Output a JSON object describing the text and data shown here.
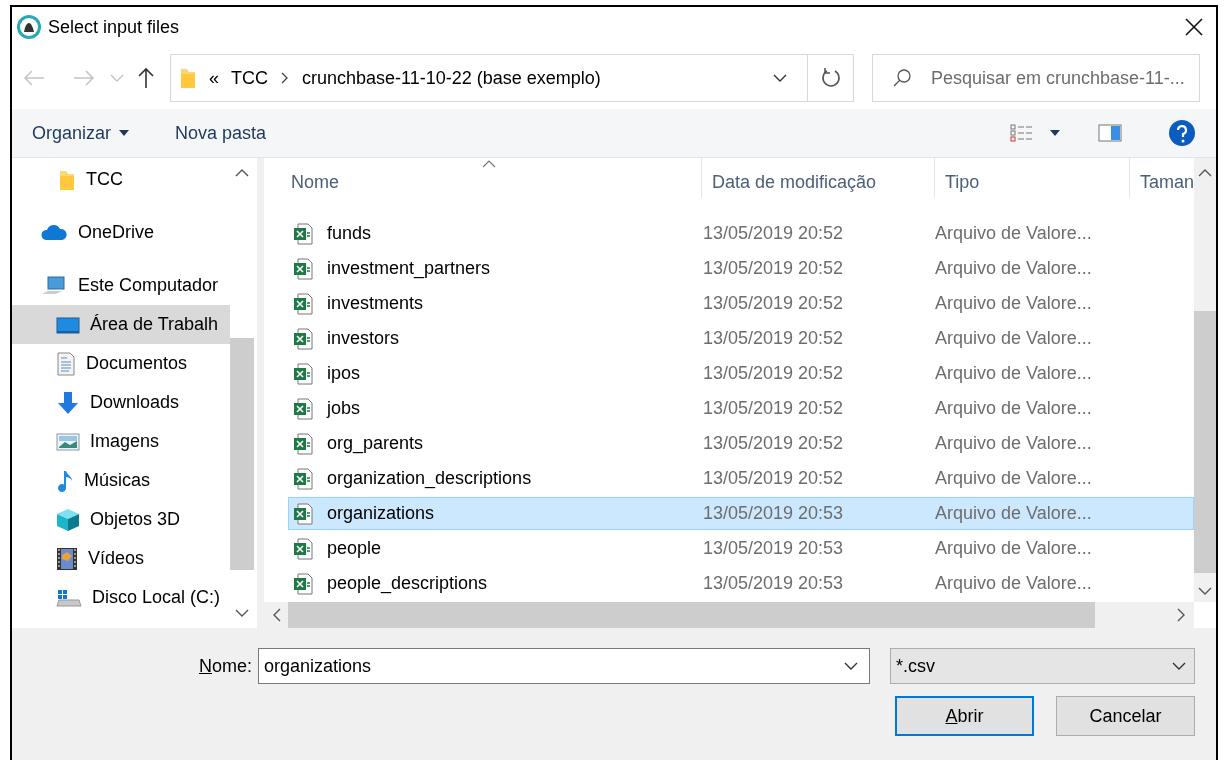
{
  "window": {
    "title": "Select input files"
  },
  "address": {
    "overflow": "«",
    "segments": [
      "TCC",
      "crunchbase-11-10-22 (base exemplo)"
    ]
  },
  "search": {
    "placeholder": "Pesquisar em crunchbase-11-..."
  },
  "toolbar": {
    "organize": "Organizar",
    "new_folder": "Nova pasta"
  },
  "nav_pane": {
    "items": [
      {
        "label": "TCC",
        "kind": "folder",
        "selected": false
      },
      {
        "label": "OneDrive",
        "kind": "cloud",
        "selected": false
      },
      {
        "label": "Este Computador",
        "kind": "computer",
        "selected": false,
        "children": [
          {
            "label": "Área de Trabalh",
            "kind": "desktop",
            "selected": true
          },
          {
            "label": "Documentos",
            "kind": "documents",
            "selected": false
          },
          {
            "label": "Downloads",
            "kind": "downloads",
            "selected": false
          },
          {
            "label": "Imagens",
            "kind": "pictures",
            "selected": false
          },
          {
            "label": "Músicas",
            "kind": "music",
            "selected": false
          },
          {
            "label": "Objetos 3D",
            "kind": "objects3d",
            "selected": false
          },
          {
            "label": "Vídeos",
            "kind": "videos",
            "selected": false
          },
          {
            "label": "Disco Local (C:)",
            "kind": "drive",
            "selected": false
          }
        ]
      }
    ]
  },
  "file_list": {
    "columns": [
      "Nome",
      "Data de modificação",
      "Tipo",
      "Taman"
    ],
    "rows": [
      {
        "name": "funds",
        "modified": "13/05/2019 20:52",
        "type": "Arquivo de Valore...",
        "selected": false
      },
      {
        "name": "investment_partners",
        "modified": "13/05/2019 20:52",
        "type": "Arquivo de Valore...",
        "selected": false
      },
      {
        "name": "investments",
        "modified": "13/05/2019 20:52",
        "type": "Arquivo de Valore...",
        "selected": false
      },
      {
        "name": "investors",
        "modified": "13/05/2019 20:52",
        "type": "Arquivo de Valore...",
        "selected": false
      },
      {
        "name": "ipos",
        "modified": "13/05/2019 20:52",
        "type": "Arquivo de Valore...",
        "selected": false
      },
      {
        "name": "jobs",
        "modified": "13/05/2019 20:52",
        "type": "Arquivo de Valore...",
        "selected": false
      },
      {
        "name": "org_parents",
        "modified": "13/05/2019 20:52",
        "type": "Arquivo de Valore...",
        "selected": false
      },
      {
        "name": "organization_descriptions",
        "modified": "13/05/2019 20:52",
        "type": "Arquivo de Valore...",
        "selected": false
      },
      {
        "name": "organizations",
        "modified": "13/05/2019 20:53",
        "type": "Arquivo de Valore...",
        "selected": true
      },
      {
        "name": "people",
        "modified": "13/05/2019 20:53",
        "type": "Arquivo de Valore...",
        "selected": false
      },
      {
        "name": "people_descriptions",
        "modified": "13/05/2019 20:53",
        "type": "Arquivo de Valore...",
        "selected": false
      }
    ]
  },
  "bottom": {
    "file_name_label": "Nome:",
    "file_name": "organizations",
    "filter": "*.csv",
    "buttons": [
      {
        "label": "Abrir",
        "default": true
      },
      {
        "label": "Cancelar",
        "default": false
      }
    ]
  }
}
